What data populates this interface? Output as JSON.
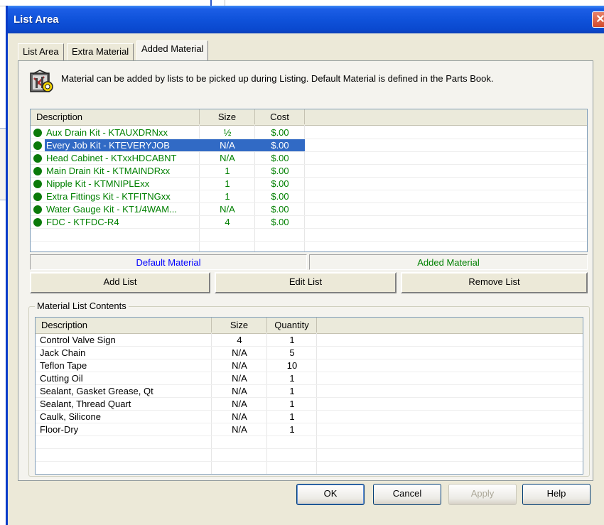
{
  "window": {
    "title": "List Area",
    "close_glyph": "✕"
  },
  "tabs": [
    {
      "label": "List Area"
    },
    {
      "label": "Extra Material"
    },
    {
      "label": "Added Material"
    }
  ],
  "info_text": "Material can be added by lists to be picked up during Listing. Default Material is defined in the Parts Book.",
  "material_lists": {
    "columns": {
      "description": "Description",
      "size": "Size",
      "cost": "Cost"
    },
    "rows": [
      {
        "description": "Aux Drain Kit - KTAUXDRNxx",
        "size": "½",
        "cost": "$.00"
      },
      {
        "description": "Every Job Kit - KTEVERYJOB",
        "size": "N/A",
        "cost": "$.00",
        "selected": true
      },
      {
        "description": "Head Cabinet - KTxxHDCABNT",
        "size": "N/A",
        "cost": "$.00"
      },
      {
        "description": "Main Drain Kit - KTMAINDRxx",
        "size": "1",
        "cost": "$.00"
      },
      {
        "description": "Nipple Kit - KTMNIPLExx",
        "size": "1",
        "cost": "$.00"
      },
      {
        "description": "Extra Fittings Kit - KTFITNGxx",
        "size": "1",
        "cost": "$.00"
      },
      {
        "description": "Water Gauge Kit - KT1/4WAM...",
        "size": "N/A",
        "cost": "$.00"
      },
      {
        "description": "FDC - KTFDC-R4",
        "size": "4",
        "cost": "$.00"
      }
    ]
  },
  "legend": {
    "default_material": "Default Material",
    "added_material": "Added Material",
    "default_color": "#0000ff",
    "added_color": "#008000"
  },
  "buttons": {
    "add_list": "Add List",
    "edit_list": "Edit List",
    "remove_list": "Remove List",
    "ok": "OK",
    "cancel": "Cancel",
    "apply": "Apply",
    "help": "Help"
  },
  "contents": {
    "group_title": "Material List Contents",
    "columns": {
      "description": "Description",
      "size": "Size",
      "quantity": "Quantity"
    },
    "rows": [
      {
        "description": "Control Valve Sign",
        "size": "4",
        "quantity": "1"
      },
      {
        "description": "Jack Chain",
        "size": "N/A",
        "quantity": "5"
      },
      {
        "description": "Teflon Tape",
        "size": "N/A",
        "quantity": "10"
      },
      {
        "description": "Cutting Oil",
        "size": "N/A",
        "quantity": "1"
      },
      {
        "description": "Sealant, Gasket Grease, Qt",
        "size": "N/A",
        "quantity": "1"
      },
      {
        "description": "Sealant, Thread Quart",
        "size": "N/A",
        "quantity": "1"
      },
      {
        "description": "Caulk, Silicone",
        "size": "N/A",
        "quantity": "1"
      },
      {
        "description": "Floor-Dry",
        "size": "N/A",
        "quantity": "1"
      }
    ]
  }
}
